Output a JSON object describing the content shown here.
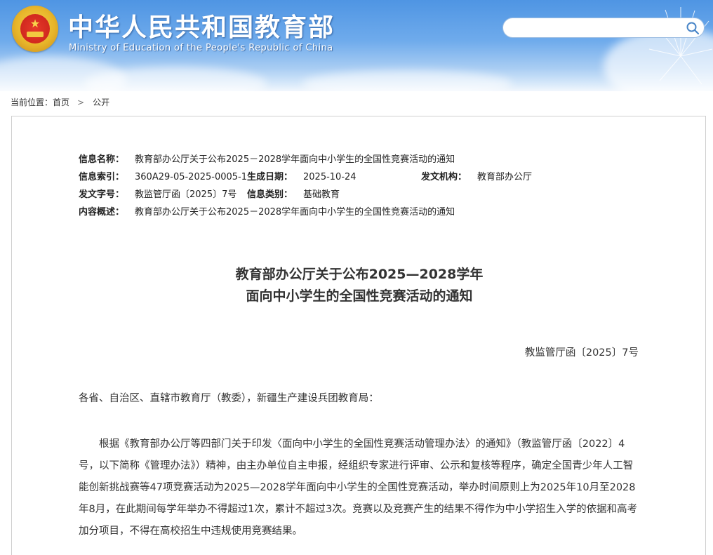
{
  "header": {
    "title": "中华人民共和国教育部",
    "subtitle": "Ministry of Education of the People's Republic of China"
  },
  "search": {
    "value": "",
    "placeholder": "",
    "icon": "search-icon"
  },
  "breadcrumb": {
    "label": "当前位置：",
    "home": "首页",
    "separator": ">",
    "current": "公开"
  },
  "meta": {
    "name_label": "信息名称：",
    "name_value": "教育部办公厅关于公布2025－2028学年面向中小学生的全国性竞赛活动的通知",
    "index_label": "信息索引：",
    "index_value": "360A29-05-2025-0005-1",
    "date_label": "生成日期：",
    "date_value": "2025-10-24",
    "issuer_label": "发文机构：",
    "issuer_value": "教育部办公厅",
    "docno_label": "发文字号：",
    "docno_value": "教监管厅函〔2025〕7号",
    "category_label": "信息类别：",
    "category_value": "基础教育",
    "summary_label": "内容概述：",
    "summary_value": "教育部办公厅关于公布2025－2028学年面向中小学生的全国性竞赛活动的通知"
  },
  "document": {
    "title_line1": "教育部办公厅关于公布2025—2028学年",
    "title_line2": "面向中小学生的全国性竞赛活动的通知",
    "number": "教监管厅函〔2025〕7号",
    "salutation": "各省、自治区、直辖市教育厅（教委），新疆生产建设兵团教育局：",
    "paragraph1": "根据《教育部办公厅等四部门关于印发〈面向中小学生的全国性竞赛活动管理办法〉的通知》（教监管厅函〔2022〕4号，以下简称《管理办法》）精神，由主办单位自主申报，经组织专家进行评审、公示和复核等程序，确定全国青少年人工智能创新挑战赛等47项竞赛活动为2025—2028学年面向中小学生的全国性竞赛活动，举办时间原则上为2025年10月至2028年8月，在此期间每学年举办不得超过1次，累计不超过3次。竞赛以及竞赛产生的结果不得作为中小学招生入学的依据和高考加分项目，不得在高校招生中违规使用竞赛结果。"
  },
  "colors": {
    "header_top": "#4f95e3",
    "header_bottom": "#f2f7fd",
    "card_border": "#cfcfcf",
    "text": "#333333"
  }
}
